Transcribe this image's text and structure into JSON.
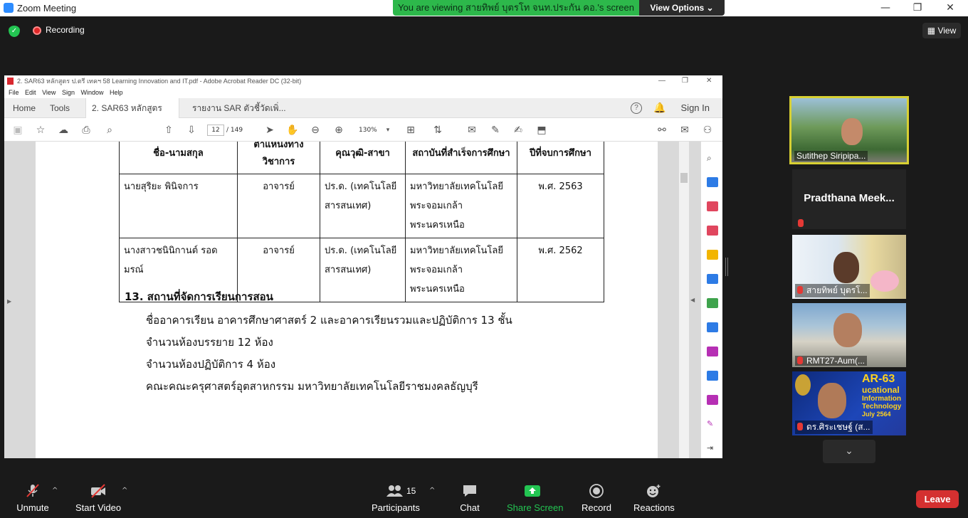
{
  "window": {
    "title": "Zoom Meeting",
    "minimize": "—",
    "maximize": "❐",
    "close": "✕"
  },
  "banner": {
    "viewing_text": "You are viewing สายทิพย์ บุตรโท จนท.ประกัน คอ.'s screen",
    "view_options": "View Options ⌄"
  },
  "status": {
    "recording": "Recording",
    "view": "View"
  },
  "acrobat": {
    "title": "2. SAR63 หลักสูตร ป.ตรี เทคฯ 58 Learning Innovation and IT.pdf - Adobe Acrobat Reader DC (32-bit)",
    "menu": [
      "File",
      "Edit",
      "View",
      "Sign",
      "Window",
      "Help"
    ],
    "tabs": {
      "home": "Home",
      "tools": "Tools",
      "doc1": "2. SAR63 หลักสูตร ป...",
      "doc1_close": "×",
      "doc2": "รายงาน SAR ตัวชี้วัดเพิ่..."
    },
    "sign_in": "Sign In",
    "page_current": "12",
    "page_total": "/ 149",
    "zoom": "130%"
  },
  "document": {
    "table_headers": [
      "ชื่อ-นามสกุล",
      "ตำแหน่งทางวิชาการ",
      "คุณวุฒิ-สาขา",
      "สถาบันที่สำเร็จการศึกษา",
      "ปีที่จบการศึกษา"
    ],
    "rows": [
      {
        "name": "นายสุริยะ พินิจการ",
        "position": "อาจารย์",
        "degree": "ปร.ด. (เทคโนโลยีสารสนเทศ)",
        "institution": "มหาวิทยาลัยเทคโนโลยีพระจอมเกล้าพระนครเหนือ",
        "year": "พ.ศ. 2563"
      },
      {
        "name": "นางสาวชนินิกานต์ รอดมรณ์",
        "position": "อาจารย์",
        "degree": "ปร.ด. (เทคโนโลยีสารสนเทศ)",
        "institution": "มหาวิทยาลัยเทคโนโลยีพระจอมเกล้าพระนครเหนือ",
        "year": "พ.ศ. 2562"
      }
    ],
    "section_title": "13. สถานที่จัดการเรียนการสอน",
    "lines": [
      "ชื่ออาคารเรียน อาคารศึกษาศาสตร์ 2 และอาคารเรียนรวมและปฏิบัติการ 13 ชั้น",
      "จำนวนห้องบรรยาย 12 ห้อง",
      "จำนวนห้องปฏิบัติการ 4 ห้อง",
      "คณะคณะครุศาสตร์อุตสาหกรรม มหาวิทยาลัยเทคโนโลยีราชมงคลธัญบุรี"
    ]
  },
  "participants_gallery": [
    {
      "name": "Sutithep Siripipa...",
      "muted": false
    },
    {
      "name": "Pradthana  Meek...",
      "muted": true
    },
    {
      "name": "สายทิพย์ บุตรโ...",
      "muted": true
    },
    {
      "name": "RMT27-Aum(...",
      "muted": true
    },
    {
      "name": "ดร.ศิระเชษฐ์ (ส...",
      "muted": true
    }
  ],
  "slide_overlay": {
    "line1": "AR-63",
    "line2": "ucational",
    "line3": "Information",
    "line4": "Technology",
    "line5": "July 2564"
  },
  "toolbar": {
    "unmute": "Unmute",
    "start_video": "Start Video",
    "participants": "Participants",
    "participant_count": "15",
    "chat": "Chat",
    "share_screen": "Share Screen",
    "record": "Record",
    "reactions": "Reactions",
    "leave": "Leave",
    "caret": "^",
    "gallery_down": "⌄"
  },
  "colors": {
    "banner_green": "#2db84b",
    "leave_red": "#d43030",
    "share_green": "#23c552",
    "background": "#1a1a1a"
  }
}
